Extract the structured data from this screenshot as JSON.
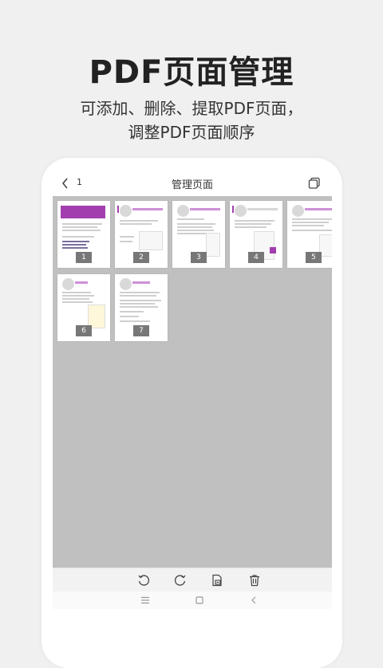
{
  "hero": {
    "title": "PDF页面管理",
    "subtitle_line1": "可添加、删除、提取PDF页面，",
    "subtitle_line2": "调整PDF页面顺序"
  },
  "app": {
    "header": {
      "back_icon": "chevron-left-icon",
      "count": "1",
      "title": "管理页面",
      "action_icon": "copy-pages-icon"
    },
    "pages": [
      "1",
      "2",
      "3",
      "4",
      "5",
      "6",
      "7"
    ],
    "toolbar": [
      "rotate-left-icon",
      "rotate-right-icon",
      "extract-page-icon",
      "delete-icon"
    ],
    "nav": [
      "menu-icon",
      "home-square-icon",
      "back-triangle-icon"
    ]
  },
  "colors": {
    "accent": "#a23fae",
    "grid_bg": "#c0c0c0",
    "badge_bg": "#777777"
  }
}
